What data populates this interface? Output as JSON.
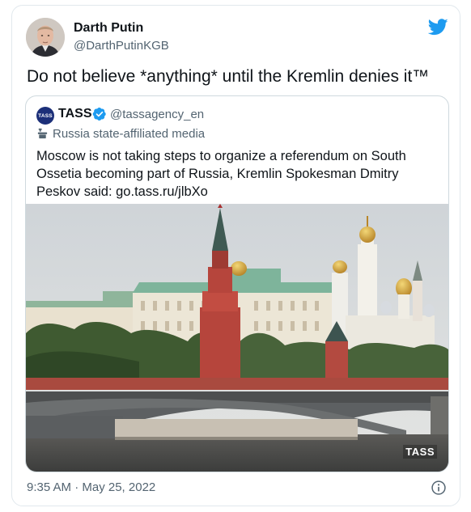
{
  "author": {
    "name": "Darth Putin",
    "handle": "@DarthPutinKGB"
  },
  "tweet": {
    "text": "Do not believe *anything* until the Kremlin denies it™"
  },
  "quoted": {
    "avatar_text": "TASS",
    "name": "TASS",
    "handle": "@tassagency_en",
    "affiliation": "Russia state-affiliated media",
    "text": "Moscow is not taking steps to organize a referendum on South Ossetia becoming part of Russia, Kremlin Spokesman Dmitry Peskov said: go.tass.ru/jlbXo",
    "watermark": "TASS"
  },
  "meta": {
    "timestamp": "9:35 AM · May 25, 2022"
  },
  "colors": {
    "twitter_blue": "#1d9bf0",
    "secondary_text": "#536471",
    "tass_navy": "#1c2f79"
  },
  "icons": {
    "brand": "twitter-bird-icon",
    "verified": "verified-badge-icon",
    "affiliation": "state-media-icon",
    "info": "info-icon"
  }
}
